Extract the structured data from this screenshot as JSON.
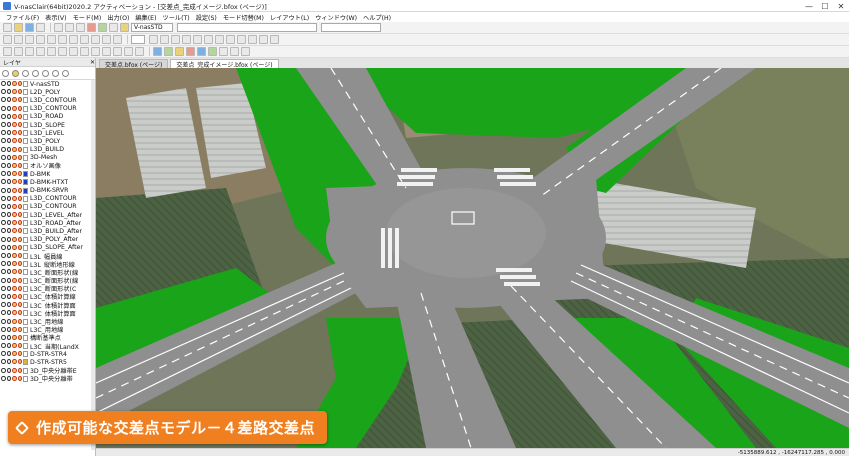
{
  "window": {
    "title": "V-nasClair(64bit)2020.2 アクティベーション - [交差点_完成イメージ.bfox (ページ)]",
    "minimize": "—",
    "maximize": "☐",
    "close": "✕"
  },
  "menu": {
    "items": [
      "ファイル(F)",
      "表示(V)",
      "モード(M)",
      "出力(O)",
      "編集(E)",
      "ツール(T)",
      "設定(S)",
      "モード切替(M)",
      "レイアウト(L)",
      "ウィンドウ(W)",
      "ヘルプ(H)"
    ]
  },
  "toolbar": {
    "style_combo": "V-nasSTD"
  },
  "layers": {
    "title": "レイヤ",
    "items": [
      {
        "name": "V-nasSTD",
        "color": "#ffffff"
      },
      {
        "name": "L2D_POLY",
        "color": "#ffffff"
      },
      {
        "name": "L3D_CONTOUR",
        "color": "#ffffff"
      },
      {
        "name": "L3D_CONTOUR",
        "color": "#ffffff"
      },
      {
        "name": "L3D_ROAD",
        "color": "#ffffff"
      },
      {
        "name": "L3D_SLOPE",
        "color": "#ffffff"
      },
      {
        "name": "L3D_LEVEL",
        "color": "#ffffff"
      },
      {
        "name": "L3D_POLY",
        "color": "#ffffff"
      },
      {
        "name": "L3D_BUILD",
        "color": "#ffffff"
      },
      {
        "name": "3D-Mesh",
        "color": "#ffffff"
      },
      {
        "name": "オルソ画像",
        "color": "#ffffff"
      },
      {
        "name": "D-BMK",
        "color": "#2040c0"
      },
      {
        "name": "D-BMK-HTXT",
        "color": "#2040c0"
      },
      {
        "name": "D-BMK-SRVR",
        "color": "#2040c0"
      },
      {
        "name": "L3D_CONTOUR",
        "color": "#ffffff"
      },
      {
        "name": "L3D_CONTOUR",
        "color": "#ffffff"
      },
      {
        "name": "L3D_LEVEL_After",
        "color": "#ffffff"
      },
      {
        "name": "L3D_ROAD_After",
        "color": "#ffffff"
      },
      {
        "name": "L3D_BUILD_After",
        "color": "#ffffff"
      },
      {
        "name": "L3D_POLY_After",
        "color": "#ffffff"
      },
      {
        "name": "L3D_SLOPE_After",
        "color": "#ffffff"
      },
      {
        "name": "L3L_幅員線",
        "color": "#ffffff"
      },
      {
        "name": "L3L_縦断地形線",
        "color": "#ffffff"
      },
      {
        "name": "L3C_断面形状(線",
        "color": "#ffffff"
      },
      {
        "name": "L3C_断面形状(線",
        "color": "#ffffff"
      },
      {
        "name": "L3C_断面形状(C",
        "color": "#ffffff"
      },
      {
        "name": "L3C_体積計算線",
        "color": "#ffffff"
      },
      {
        "name": "L3C_体積計算面",
        "color": "#ffffff"
      },
      {
        "name": "L3C_体積計算面",
        "color": "#ffffff"
      },
      {
        "name": "L3C_用地線",
        "color": "#ffffff"
      },
      {
        "name": "L3C_用地線",
        "color": "#ffffff"
      },
      {
        "name": "構断基準点",
        "color": "#ffffff"
      },
      {
        "name": "L3C_当期(LandX",
        "color": "#ffffff"
      },
      {
        "name": "D-STR-STR4",
        "color": "#ffffff"
      },
      {
        "name": "D-STR-STR5",
        "color": "#e0b040"
      },
      {
        "name": "3D_中央分離帯E",
        "color": "#ffffff"
      },
      {
        "name": "3D_中央分離帯",
        "color": "#ffffff"
      }
    ]
  },
  "tabs": [
    {
      "label": "交差点.bfox (ページ)",
      "active": false
    },
    {
      "label": "交差点_完成イメージ.bfox (ページ)",
      "active": true
    }
  ],
  "caption": {
    "text": "作成可能な交差点モデル－４差路交差点"
  },
  "status": {
    "coords": "-5135889.612 , -16247117.285 , 0.000"
  }
}
